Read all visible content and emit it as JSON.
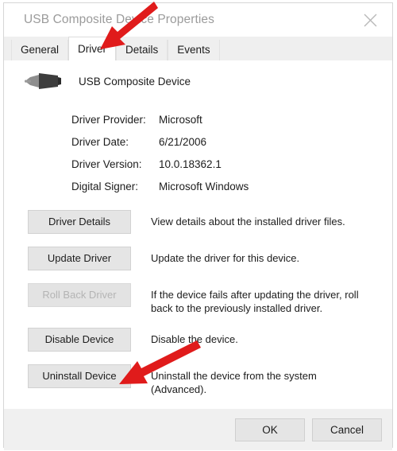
{
  "window": {
    "title": "USB Composite Device Properties",
    "close_icon": "close-icon"
  },
  "tabs": [
    {
      "label": "General",
      "active": false
    },
    {
      "label": "Driver",
      "active": true
    },
    {
      "label": "Details",
      "active": false
    },
    {
      "label": "Events",
      "active": false
    }
  ],
  "device": {
    "icon": "usb-connector-icon",
    "name": "USB Composite Device"
  },
  "driver_info": [
    {
      "label": "Driver Provider:",
      "value": "Microsoft"
    },
    {
      "label": "Driver Date:",
      "value": "6/21/2006"
    },
    {
      "label": "Driver Version:",
      "value": "10.0.18362.1"
    },
    {
      "label": "Digital Signer:",
      "value": "Microsoft Windows"
    }
  ],
  "actions": [
    {
      "label": "Driver Details",
      "description": "View details about the installed driver files.",
      "disabled": false
    },
    {
      "label": "Update Driver",
      "description": "Update the driver for this device.",
      "disabled": false
    },
    {
      "label": "Roll Back Driver",
      "description": "If the device fails after updating the driver, roll back to the previously installed driver.",
      "disabled": true
    },
    {
      "label": "Disable Device",
      "description": "Disable the device.",
      "disabled": false
    },
    {
      "label": "Uninstall Device",
      "description": "Uninstall the device from the system (Advanced).",
      "disabled": false
    }
  ],
  "footer": {
    "ok_label": "OK",
    "cancel_label": "Cancel"
  },
  "annotations": {
    "color": "#e01b1b",
    "arrows": [
      {
        "name": "arrow-to-driver-tab",
        "target": "Driver tab"
      },
      {
        "name": "arrow-to-uninstall-device",
        "target": "Uninstall Device button"
      }
    ]
  }
}
